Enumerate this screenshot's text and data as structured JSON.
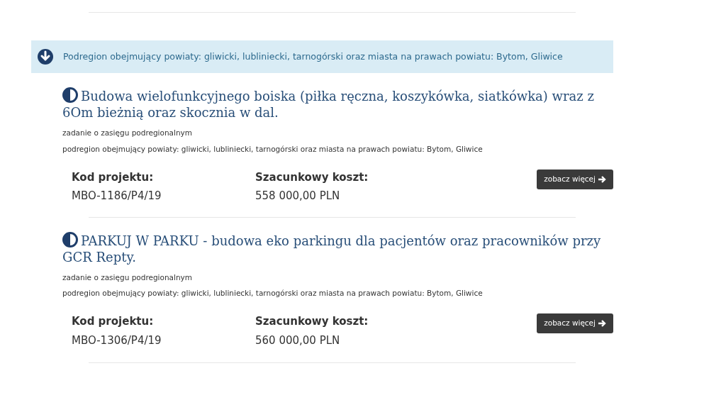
{
  "region_banner": {
    "text": "Podregion obejmujący powiaty: gliwicki, lubliniecki, tarnogórski oraz miasta na prawach powiatu: Bytom, Gliwice"
  },
  "projects": [
    {
      "title": "Budowa wielofunkcyjnego boiska (piłka ręczna, koszykówka, siatkówka) wraz z 6Om bieżnią oraz skocznia w dal.",
      "scope": "zadanie o zasięgu podregionalnym",
      "region": "podregion obejmujący powiaty: gliwicki, lubliniecki, tarnogórski oraz miasta na prawach powiatu: Bytom, Gliwice",
      "code_label": "Kod projektu:",
      "code": "MBO-1186/P4/19",
      "cost_label": "Szacunkowy koszt:",
      "cost": "558 000,00 PLN",
      "button": "zobacz więcej"
    },
    {
      "title": "PARKUJ W PARKU - budowa eko parkingu dla pacjentów oraz pracowników przy GCR Repty.",
      "scope": "zadanie o zasięgu podregionalnym",
      "region": "podregion obejmujący powiaty: gliwicki, lubliniecki, tarnogórski oraz miasta na prawach powiatu: Bytom, Gliwice",
      "code_label": "Kod projektu:",
      "code": "MBO-1306/P4/19",
      "cost_label": "Szacunkowy koszt:",
      "cost": "560 000,00 PLN",
      "button": "zobacz więcej"
    }
  ]
}
